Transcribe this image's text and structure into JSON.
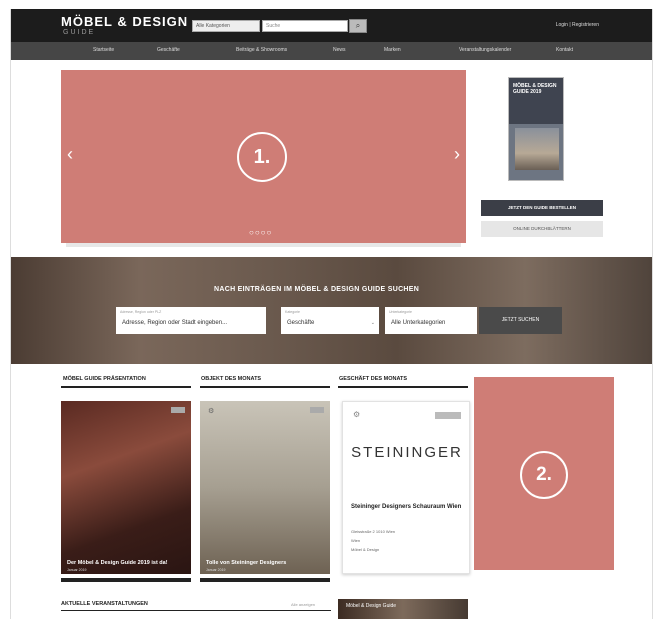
{
  "header": {
    "logo": "MÖBEL & DESIGN",
    "logo_sub": "GUIDE",
    "category_select": "Alle Kategorien",
    "search_placeholder": "Suche",
    "login": "Login | Registrieren"
  },
  "nav": {
    "items": [
      "Startseite",
      "Geschäfte",
      "Beiträge & Showrooms",
      "News",
      "Marken",
      "Veranstaltungskalender",
      "Kontakt"
    ]
  },
  "slider": {
    "marker": "1.",
    "dots": "○○○○"
  },
  "magazine": {
    "title": "MÖBEL & DESIGN GUIDE 2019",
    "order_button": "JETZT DEN GUIDE BESTELLEN",
    "read_button": "ONLINE DURCHBLÄTTERN"
  },
  "hero": {
    "title": "NACH EINTRÄGEN IM MÖBEL & DESIGN GUIDE SUCHEN",
    "location_caption": "Adresse, Region oder PLZ",
    "location_value": "Adresse, Region oder Stadt eingeben...",
    "type_caption": "Kategorie",
    "type_value": "Geschäfte",
    "sub_caption": "Unterkategorie",
    "sub_value": "Alle Unterkategorien",
    "search_button": "JETZT SUCHEN"
  },
  "columns": {
    "col1_heading": "MÖBEL GUIDE PRÄSENTATION",
    "col2_heading": "OBJEKT DES MONATS",
    "col3_heading": "GESCHÄFT DES MONATS",
    "card1_caption": "Der Möbel & Design Guide 2019 ist da!",
    "card1_date": "Januar 2019",
    "card2_caption": "Tolle von Steininger Designers",
    "card2_date": "Januar 2019",
    "shop_brand": "STEININGER",
    "shop_title": "Steininger Designers Schauraum Wien",
    "shop_details": [
      "Gleisstraße 2 1010 Wien",
      "Wien",
      "Möbel & Design"
    ]
  },
  "ad": {
    "marker": "2."
  },
  "bottom": {
    "heading": "AKTUELLE VERANSTALTUNGEN",
    "more": "Alle anzeigen",
    "image_text": "Möbel & Design Guide"
  }
}
